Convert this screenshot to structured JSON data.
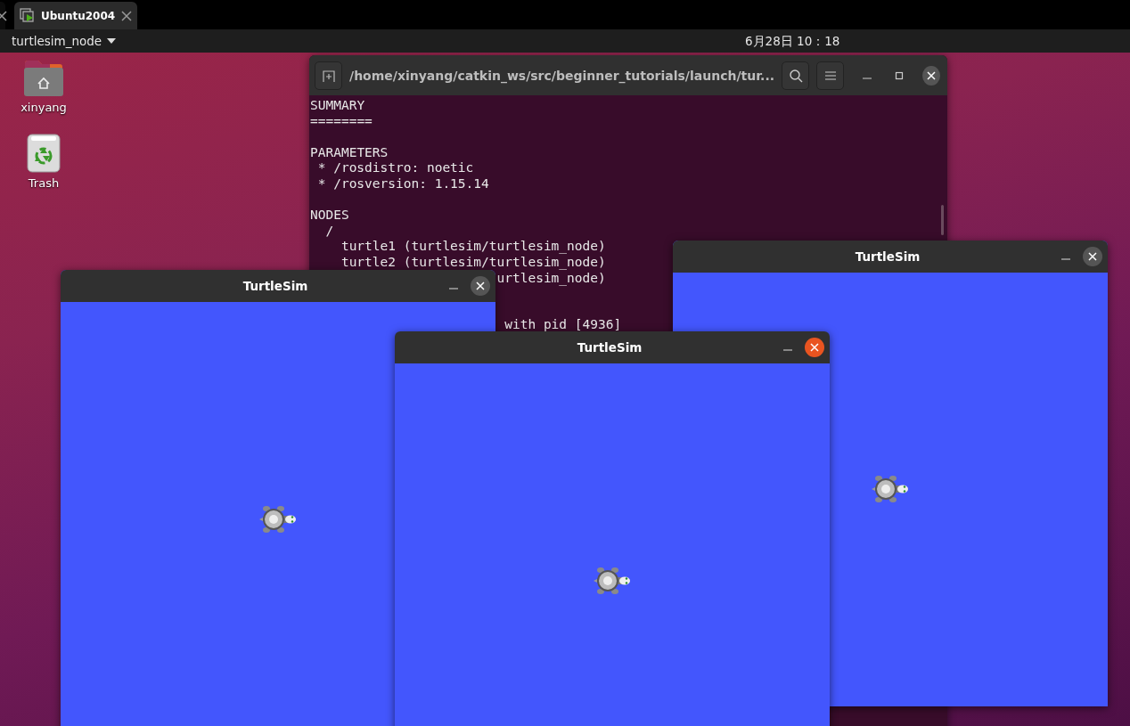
{
  "top_bar": {
    "tabs": [
      {
        "selected": false
      },
      {
        "label": "Ubuntu2004",
        "selected": true
      }
    ]
  },
  "panel": {
    "app_menu": "turtlesim_node",
    "clock": "6月28日 10：18"
  },
  "desktop_icons": [
    {
      "kind": "home",
      "label": "xinyang"
    },
    {
      "kind": "trash",
      "label": "Trash"
    }
  ],
  "terminal": {
    "title": "/home/xinyang/catkin_ws/src/beginner_tutorials/launch/tur...",
    "lines": [
      {
        "kind": "text",
        "text": "SUMMARY"
      },
      {
        "kind": "text",
        "text": "========"
      },
      {
        "kind": "blank"
      },
      {
        "kind": "text",
        "text": "PARAMETERS"
      },
      {
        "kind": "text",
        "text": " * /rosdistro: noetic"
      },
      {
        "kind": "text",
        "text": " * /rosversion: 1.15.14"
      },
      {
        "kind": "blank"
      },
      {
        "kind": "text",
        "text": "NODES"
      },
      {
        "kind": "text",
        "text": "  /"
      },
      {
        "kind": "text",
        "text": "    turtle1 (turtlesim/turtlesim_node)"
      },
      {
        "kind": "text",
        "text": "    turtle2 (turtlesim/turtlesim_node)"
      },
      {
        "kind": "text",
        "text": "                        urtlesim_node)"
      },
      {
        "kind": "blank"
      },
      {
        "kind": "blank"
      },
      {
        "kind": "text",
        "text": "                         with pid [4936]"
      }
    ]
  },
  "turtlesim_windows": [
    {
      "title": "TurtleSim",
      "focused": false
    },
    {
      "title": "TurtleSim",
      "focused": false
    },
    {
      "title": "TurtleSim",
      "focused": true
    }
  ]
}
